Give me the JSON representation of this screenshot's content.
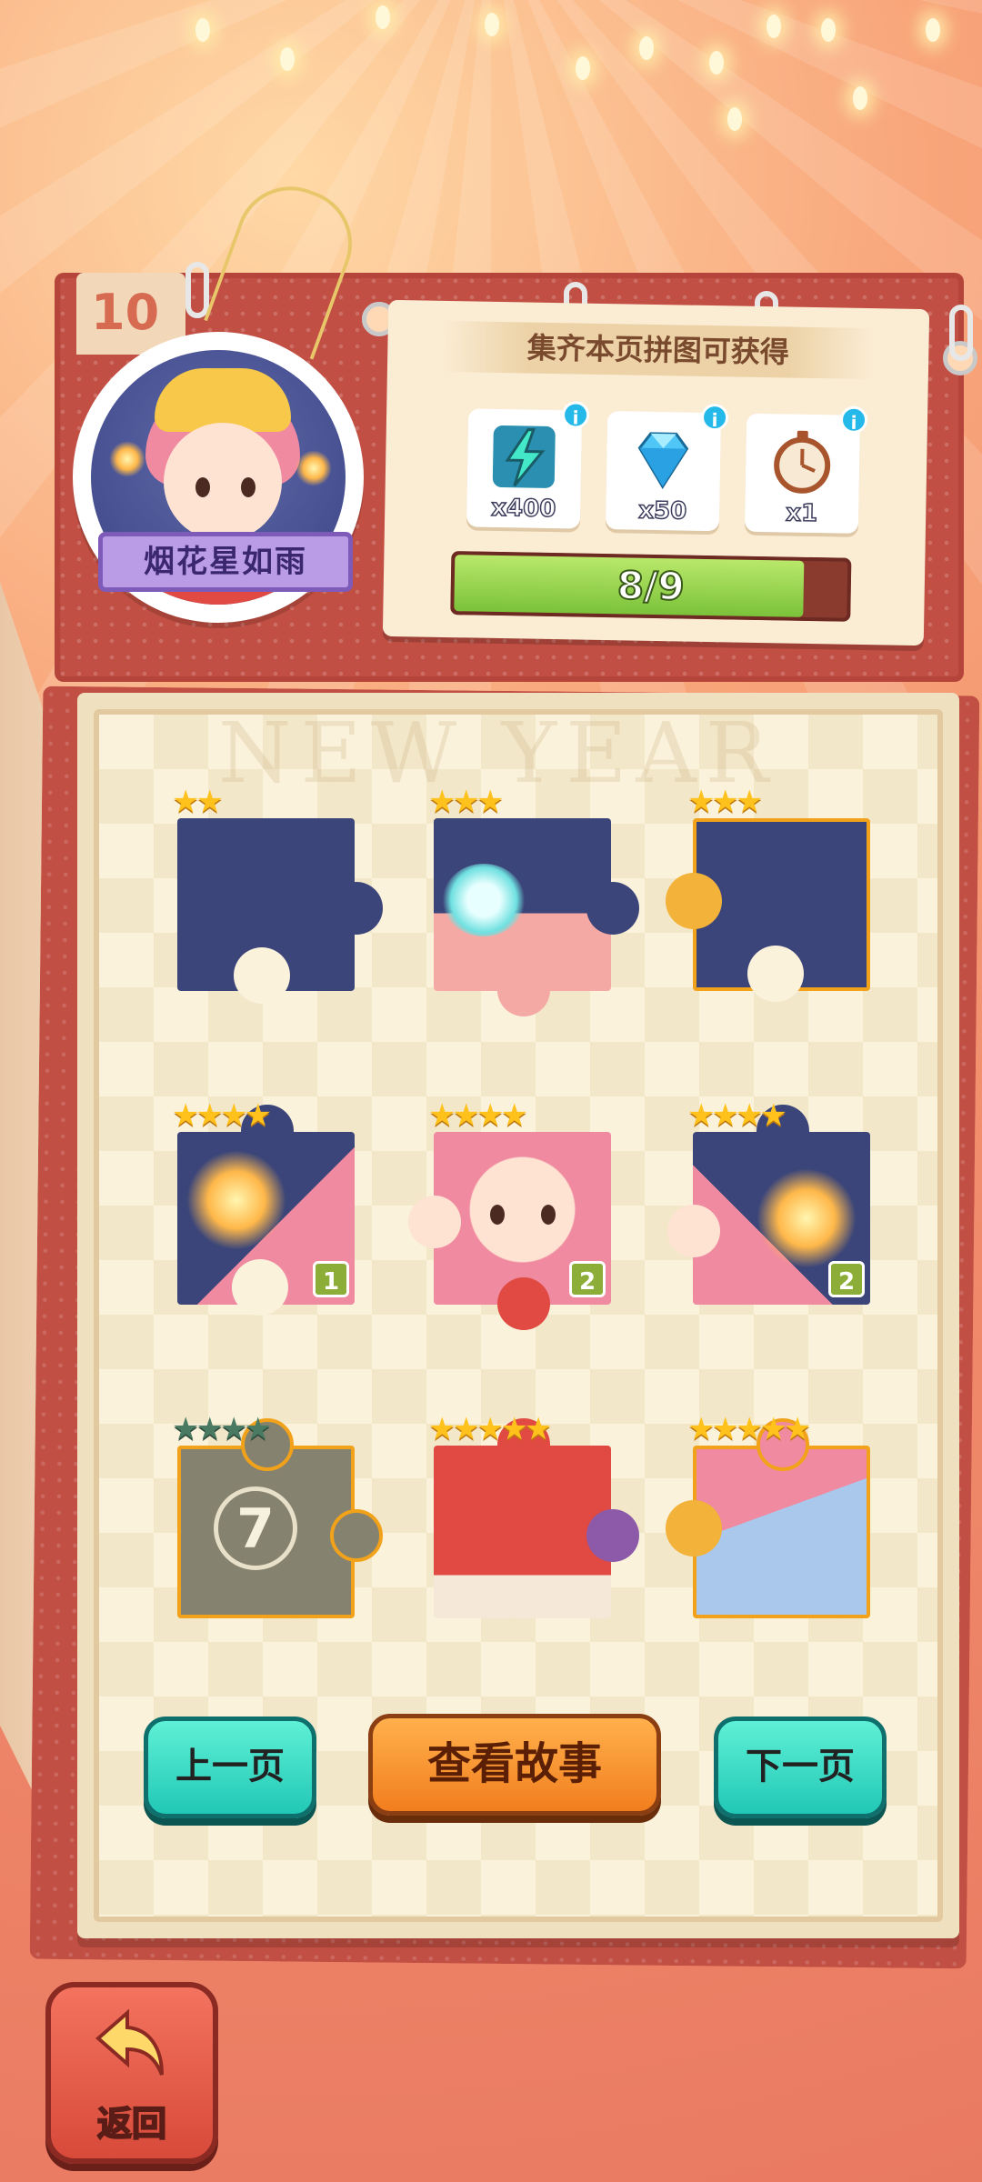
{
  "header": {
    "page_number": "10",
    "character_name": "烟花星如雨"
  },
  "rewards": {
    "title": "集齐本页拼图可获得",
    "items": [
      {
        "icon": "lightning-energy-icon",
        "qty": "x400",
        "info": "i"
      },
      {
        "icon": "blue-diamond-icon",
        "qty": "x50",
        "info": "i"
      },
      {
        "icon": "stopwatch-icon",
        "qty": "x1",
        "info": "i"
      }
    ],
    "progress_label": "8/9",
    "progress_fraction": 0.89
  },
  "album": {
    "watermark": "NEW YEAR",
    "pieces": [
      {
        "stars": "★★",
        "count": "",
        "locked": false
      },
      {
        "stars": "★★★",
        "count": "",
        "locked": false,
        "highlight": "paw-icon"
      },
      {
        "stars": "★★★",
        "count": "",
        "locked": false
      },
      {
        "stars": "★★★★",
        "count": "1",
        "locked": false
      },
      {
        "stars": "★★★★",
        "count": "2",
        "locked": false
      },
      {
        "stars": "★★★★",
        "count": "2",
        "locked": false
      },
      {
        "stars": "★★★★",
        "count": "",
        "locked": true,
        "lock_number": "7"
      },
      {
        "stars": "★★★★★",
        "count": "",
        "locked": false
      },
      {
        "stars": "★★★★★",
        "count": "",
        "locked": false
      }
    ]
  },
  "buttons": {
    "prev": "上一页",
    "story": "查看故事",
    "next": "下一页",
    "back": "返回"
  },
  "colors": {
    "board_red": "#c24f44",
    "teal_button": "#21c8b6",
    "orange_button": "#f27e1e",
    "progress_green": "#7bc23a",
    "star_gold": "#ffc21c"
  }
}
